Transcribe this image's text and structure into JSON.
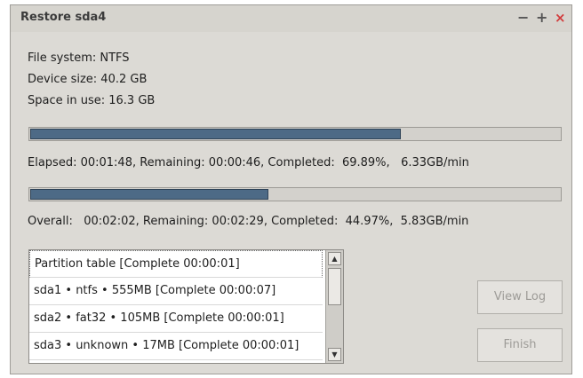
{
  "window": {
    "title": "Restore sda4",
    "minimize_glyph": "−",
    "maximize_glyph": "+",
    "close_glyph": "×"
  },
  "info": {
    "file_system": "File system:  NTFS",
    "device_size": "Device size:   40.2 GB",
    "space_in_use": "Space in use:  16.3 GB"
  },
  "partition_progress": {
    "percent": 69.89,
    "status": "Elapsed: 00:01:48, Remaining: 00:00:46, Completed:  69.89%,   6.33GB/min"
  },
  "overall_progress": {
    "percent": 44.97,
    "status": "Overall:   00:02:02, Remaining: 00:02:29, Completed:  44.97%,  5.83GB/min"
  },
  "partitions": [
    "Partition table [Complete 00:00:01]",
    "sda1 • ntfs • 555MB [Complete 00:00:07]",
    "sda2 • fat32 • 105MB [Complete 00:00:01]",
    "sda3 • unknown • 17MB [Complete 00:00:01]"
  ],
  "buttons": {
    "view_log": "View Log",
    "finish": "Finish"
  },
  "colors": {
    "progress_fill": "#4d6a86",
    "close_button": "#d23c3c"
  }
}
